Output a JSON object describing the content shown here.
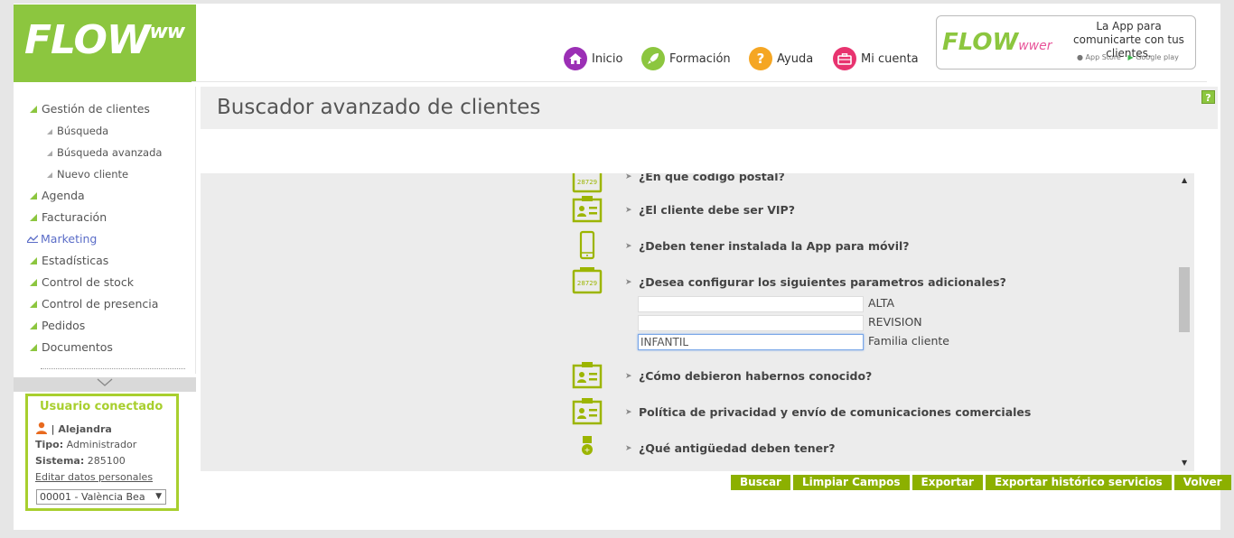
{
  "brand": {
    "logo": "FLOW",
    "logo_sup": "ww",
    "accent": "#8cc63f"
  },
  "top_nav": [
    {
      "label": "Inicio",
      "icon": "home-icon",
      "color": "#9b2fb5"
    },
    {
      "label": "Formación",
      "icon": "rocket-icon",
      "color": "#8cc63f"
    },
    {
      "label": "Ayuda",
      "icon": "question-icon",
      "color": "#f5a623"
    },
    {
      "label": "Mi cuenta",
      "icon": "briefcase-icon",
      "color": "#e8336f"
    }
  ],
  "promo": {
    "logo": "FLOW",
    "logo_sup": "wwer",
    "text": "La App para comunicarte con tus clientes.",
    "app_store": "App Store",
    "google_play": "Google play"
  },
  "sidebar": {
    "items": [
      {
        "label": "Gestión de clientes"
      },
      {
        "label": "Búsqueda"
      },
      {
        "label": "Búsqueda avanzada"
      },
      {
        "label": "Nuevo cliente"
      },
      {
        "label": "Agenda"
      },
      {
        "label": "Facturación"
      },
      {
        "label": "Marketing"
      },
      {
        "label": "Estadísticas"
      },
      {
        "label": "Control de stock"
      },
      {
        "label": "Control de presencia"
      },
      {
        "label": "Pedidos"
      },
      {
        "label": "Documentos"
      }
    ]
  },
  "user": {
    "title": "Usuario conectado",
    "name": "| Alejandra",
    "tipo_label": "Tipo:",
    "tipo_value": "Administrador",
    "sistema_label": "Sistema:",
    "sistema_value": "285100",
    "edit_link": "Editar datos personales",
    "center_select": "00001 - València Bea"
  },
  "main": {
    "title": "Buscador avanzado de clientes",
    "help_badge": "?",
    "questions": [
      {
        "label": "¿En qué código postal?",
        "icon": "calendar-28729-icon"
      },
      {
        "label": "¿El cliente debe ser VIP?",
        "icon": "id-card-icon"
      },
      {
        "label": "¿Deben tener instalada la App para móvil?",
        "icon": "mobile-phone-icon"
      },
      {
        "label": "¿Desea configurar los siguientes parametros adicionales?",
        "icon": "calendar-28729-icon"
      },
      {
        "label": "¿Cómo debieron habernos conocido?",
        "icon": "id-card-icon"
      },
      {
        "label": "Política de privacidad y envío de comunicaciones comerciales",
        "icon": "id-card-icon"
      },
      {
        "label": "¿Qué antigüedad deben tener?",
        "icon": "medal-icon"
      }
    ],
    "calendar_number": "28729",
    "params": [
      {
        "label": "ALTA",
        "value": ""
      },
      {
        "label": "REVISION",
        "value": ""
      },
      {
        "label": "Familia cliente",
        "value": "INFANTIL"
      }
    ]
  },
  "actions": {
    "buscar": "Buscar",
    "limpiar": "Limpiar Campos",
    "exportar": "Exportar",
    "exportar_hist": "Exportar histórico servicios",
    "volver": "Volver"
  }
}
